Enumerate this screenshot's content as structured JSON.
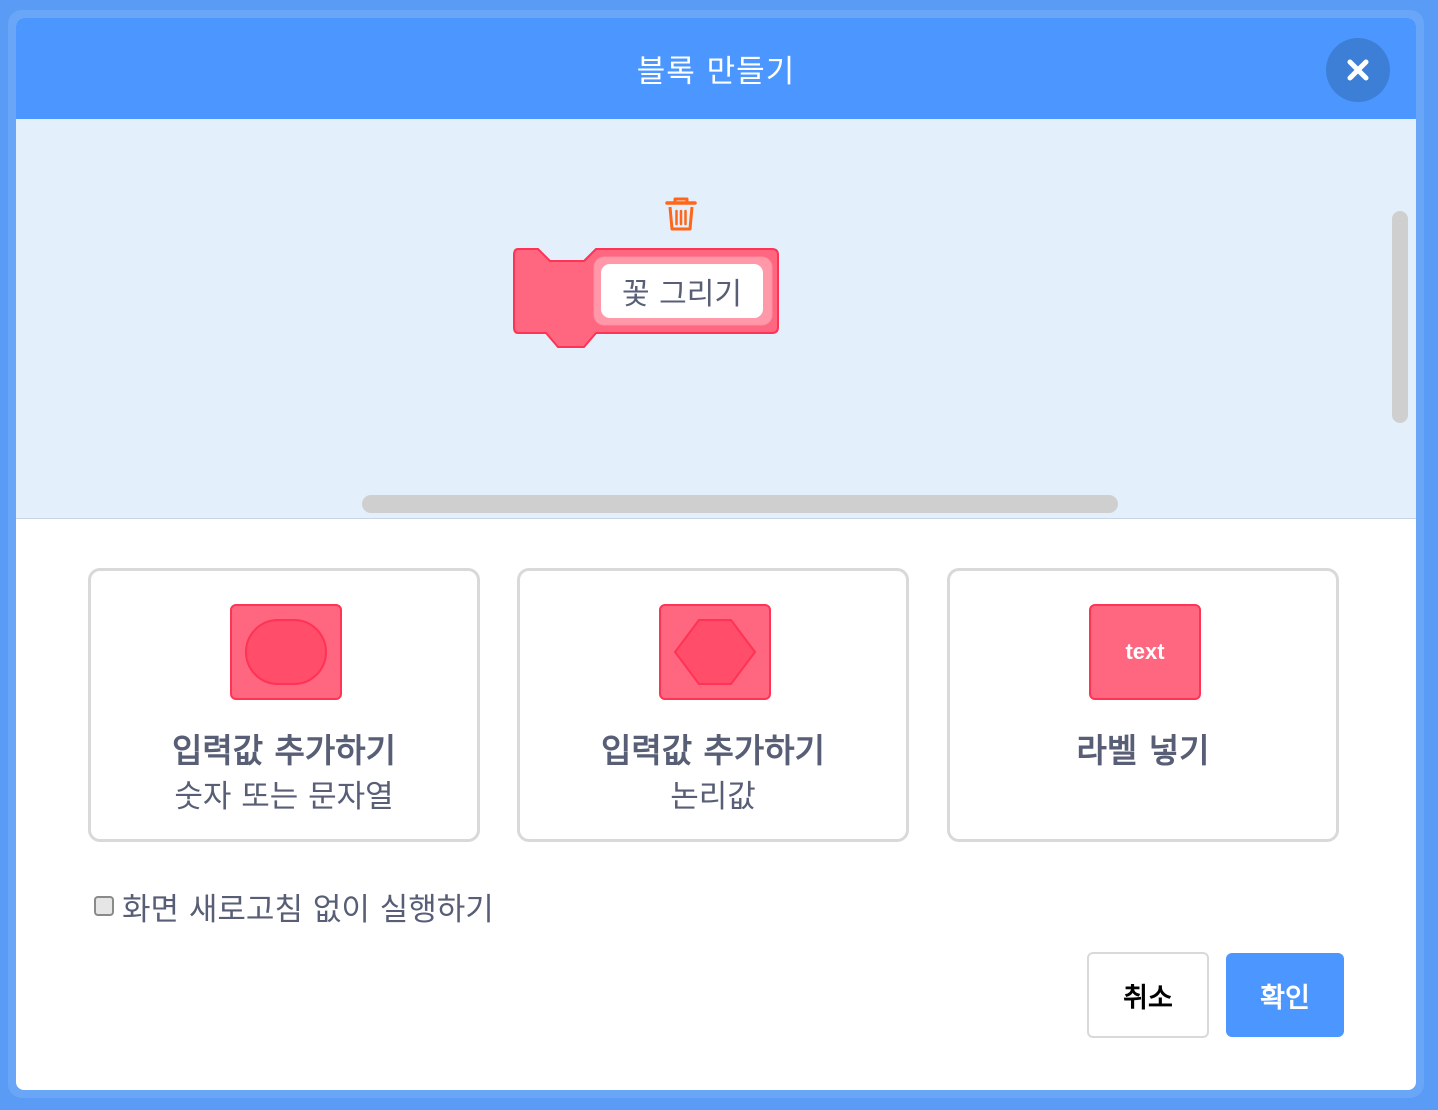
{
  "dialog": {
    "title": "블록 만들기",
    "close_icon": "close-icon"
  },
  "workspace": {
    "delete_icon": "trash-icon",
    "block_name_value": "꽃 그리기",
    "block_color": "#ff6680"
  },
  "options": [
    {
      "icon": "round-input-icon",
      "title": "입력값 추가하기",
      "subtitle": "숫자 또는 문자열"
    },
    {
      "icon": "boolean-input-icon",
      "title": "입력값 추가하기",
      "subtitle": "논리값"
    },
    {
      "icon": "label-text-icon",
      "icon_text": "text",
      "title": "라벨 넣기",
      "subtitle": ""
    }
  ],
  "run_without_refresh": {
    "label": "화면 새로고침 없이 실행하기",
    "checked": false
  },
  "buttons": {
    "cancel_label": "취소",
    "ok_label": "확인"
  },
  "colors": {
    "header": "#4c97ff",
    "workspace": "#e4effc",
    "block": "#ff6680",
    "block_border": "#ff3355",
    "text": "#575e75",
    "trash": "#ff661a"
  }
}
